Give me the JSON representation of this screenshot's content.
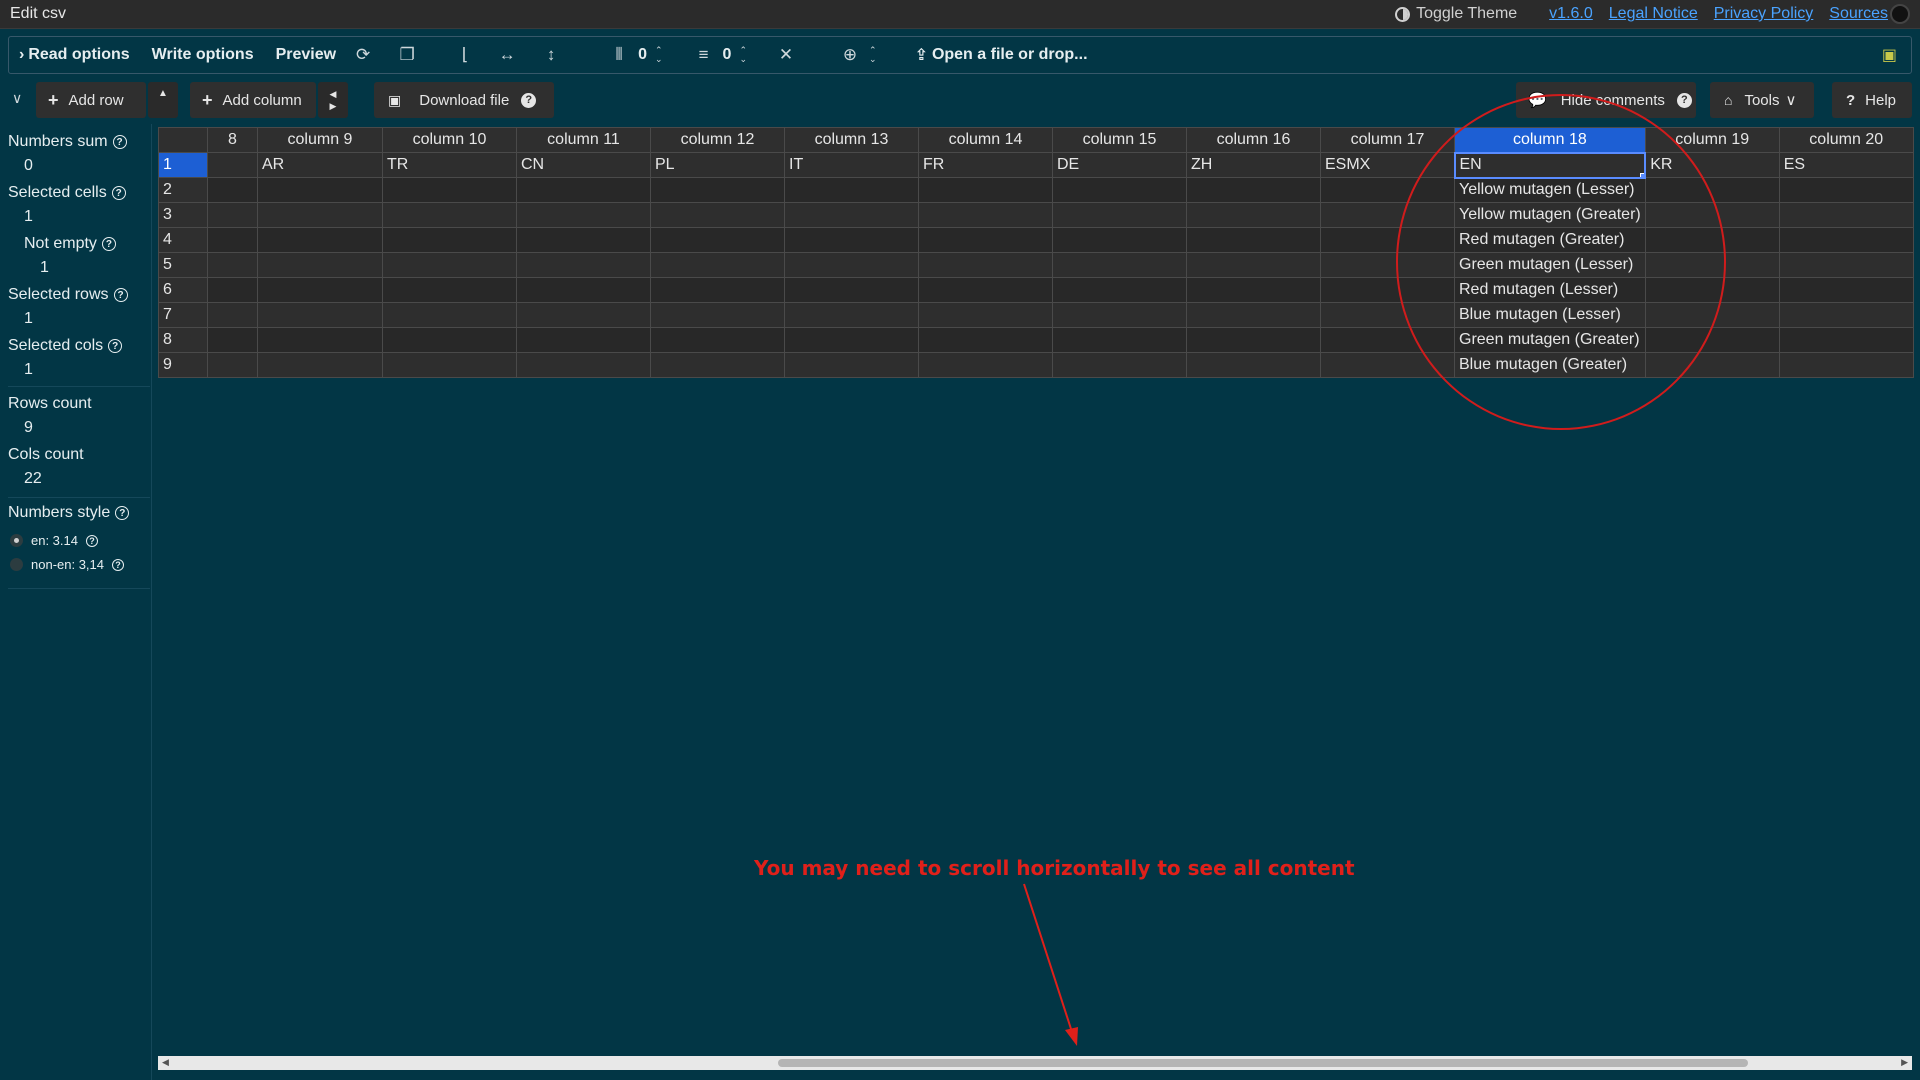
{
  "app": {
    "title": "Edit csv",
    "toggle_theme": "Toggle Theme",
    "links": [
      "v1.6.0",
      "Legal Notice",
      "Privacy Policy",
      "Sources"
    ]
  },
  "toolbar1": {
    "read_options": "Read options",
    "write_options": "Write options",
    "preview": "Preview",
    "fixed_cols_value": "0",
    "fixed_rows_value": "0",
    "open_file": "Open a file or drop..."
  },
  "toolbar2": {
    "add_row": "Add row",
    "add_column": "Add column",
    "download_file": "Download file",
    "hide_comments": "Hide comments",
    "tools": "Tools",
    "help": "Help"
  },
  "side": {
    "numbers_sum_label": "Numbers sum",
    "numbers_sum_value": "0",
    "selected_cells_label": "Selected cells",
    "selected_cells_value": "1",
    "not_empty_label": "Not empty",
    "not_empty_value": "1",
    "selected_rows_label": "Selected rows",
    "selected_rows_value": "1",
    "selected_cols_label": "Selected cols",
    "selected_cols_value": "1",
    "rows_count_label": "Rows count",
    "rows_count_value": "9",
    "cols_count_label": "Cols count",
    "cols_count_value": "22",
    "numbers_style_label": "Numbers style",
    "style_en": "en: 3.14",
    "style_non_en": "non-en: 3,14"
  },
  "grid": {
    "headers": [
      "8",
      "column 9",
      "column 10",
      "column 11",
      "column 12",
      "column 13",
      "column 14",
      "column 15",
      "column 16",
      "column 17",
      "column 18",
      "column 19",
      "column 20"
    ],
    "rows": [
      [
        "",
        "AR",
        "TR",
        "CN",
        "PL",
        "IT",
        "FR",
        "DE",
        "ZH",
        "ESMX",
        "EN",
        "KR",
        "ES"
      ],
      [
        "",
        "",
        "",
        "",
        "",
        "",
        "",
        "",
        "",
        "",
        "Yellow mutagen (Lesser)",
        "",
        ""
      ],
      [
        "",
        "",
        "",
        "",
        "",
        "",
        "",
        "",
        "",
        "",
        "Yellow mutagen (Greater)",
        "",
        ""
      ],
      [
        "",
        "",
        "",
        "",
        "",
        "",
        "",
        "",
        "",
        "",
        "Red mutagen (Greater)",
        "",
        ""
      ],
      [
        "",
        "",
        "",
        "",
        "",
        "",
        "",
        "",
        "",
        "",
        "Green mutagen (Lesser)",
        "",
        ""
      ],
      [
        "",
        "",
        "",
        "",
        "",
        "",
        "",
        "",
        "",
        "",
        "Red mutagen (Lesser)",
        "",
        ""
      ],
      [
        "",
        "",
        "",
        "",
        "",
        "",
        "",
        "",
        "",
        "",
        "Blue mutagen (Lesser)",
        "",
        ""
      ],
      [
        "",
        "",
        "",
        "",
        "",
        "",
        "",
        "",
        "",
        "",
        "Green mutagen (Greater)",
        "",
        ""
      ],
      [
        "",
        "",
        "",
        "",
        "",
        "",
        "",
        "",
        "",
        "",
        "Blue mutagen (Greater)",
        "",
        ""
      ]
    ]
  },
  "annotation": {
    "hint": "You may need to scroll horizontally to see all content"
  },
  "colors": {
    "background": "#023645",
    "selection": "#1d5fd4",
    "annotation": "#e0201a",
    "link": "#4aa3ff"
  }
}
